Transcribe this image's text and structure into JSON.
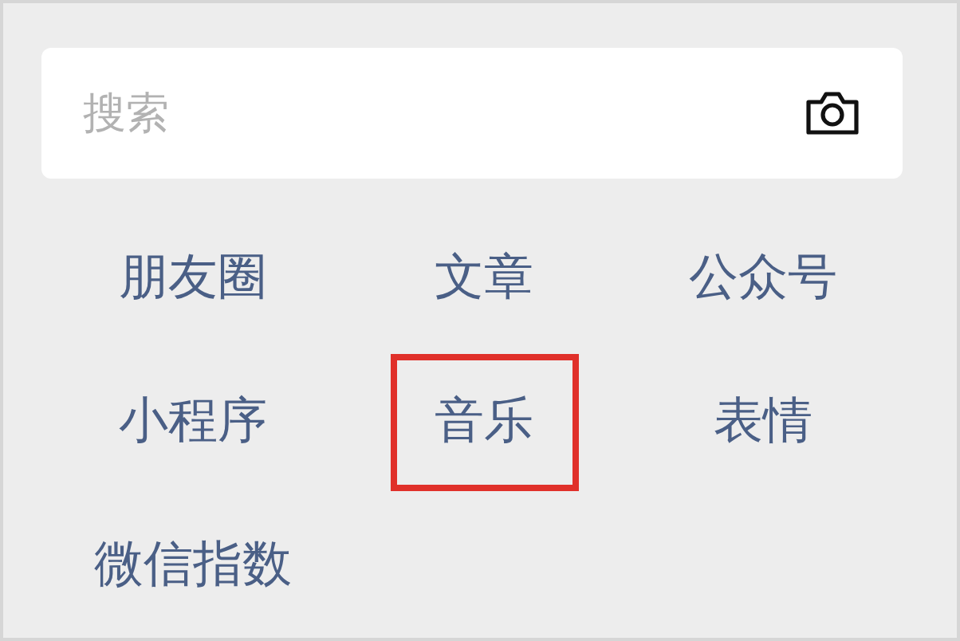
{
  "search": {
    "placeholder": "搜索"
  },
  "categories": [
    {
      "label": "朋友圈",
      "highlighted": false
    },
    {
      "label": "文章",
      "highlighted": false
    },
    {
      "label": "公众号",
      "highlighted": false
    },
    {
      "label": "小程序",
      "highlighted": false
    },
    {
      "label": "音乐",
      "highlighted": true
    },
    {
      "label": "表情",
      "highlighted": false
    },
    {
      "label": "微信指数",
      "highlighted": false
    }
  ]
}
